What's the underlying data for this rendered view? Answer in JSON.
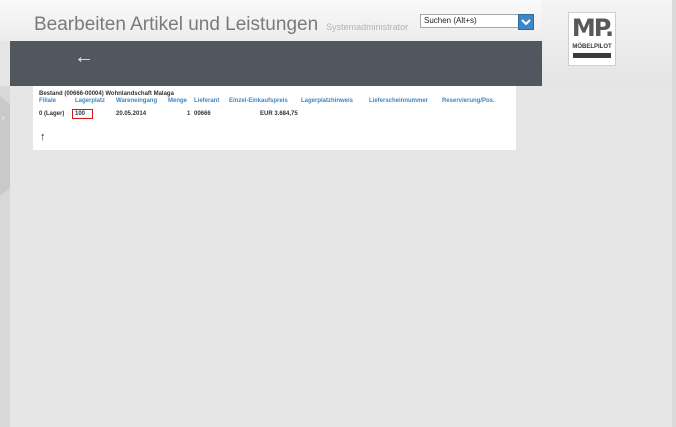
{
  "header": {
    "title": "Bearbeiten Artikel und Leistungen",
    "user": "Systemadministrator",
    "search_value": "Suchen (Alt+s)",
    "logo_mark": "MP.",
    "logo_word": "MÖBELPILOT"
  },
  "nav": {
    "back_glyph": "←",
    "side_glyph": "›"
  },
  "bestand": {
    "heading": "Bestand (00666-00004) Wohnlandschaft Malaga",
    "columns": {
      "filiale": "Filiale",
      "lagerplatz": "Lagerplatz",
      "wareneingang": "Wareneingang",
      "menge": "Menge",
      "lieferant": "Lieferant",
      "einzel_ek": "Einzel-Einkaufspreis",
      "lagerplatzhinweis": "Lagerplatzhinweis",
      "lieferscheinnummer": "Lieferscheinnummer",
      "reservierung": "Reservierung/Pos."
    },
    "row": {
      "filiale": "0 (Lager)",
      "lagerplatz": "100",
      "wareneingang": "20.05.2014",
      "menge": "1",
      "lieferant": "00666",
      "einzel_ek": "EUR 3.684,75"
    },
    "up_glyph": "↑"
  },
  "colors": {
    "accent": "#3f86c6",
    "band": "#50575f",
    "highlight": "#d01818"
  }
}
